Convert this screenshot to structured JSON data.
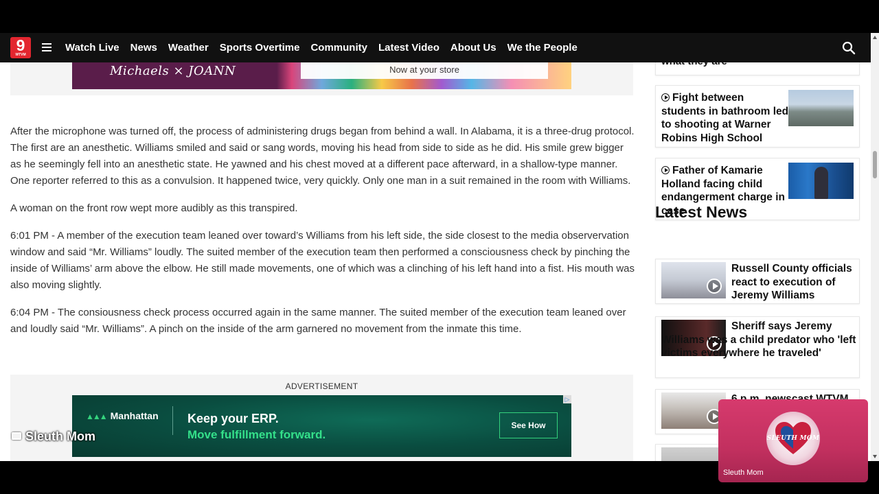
{
  "nav": {
    "logo_number": "9",
    "logo_call": "WTVM",
    "items": [
      "Watch Live",
      "News",
      "Weather",
      "Sports Overtime",
      "Community",
      "Latest Video",
      "About Us",
      "We the People"
    ]
  },
  "top_ad": {
    "brand": "Michaels × JOANN",
    "cta": "Now at your store"
  },
  "article": {
    "paragraphs": [
      "After the microphone was turned off, the process of administering drugs began from behind a wall. In Alabama, it is a three-drug protocol. The first are an anesthetic. Williams smiled and said or sang words, moving his head from side to side as he did. His smile grew bigger as he seemingly fell into an anesthetic state. He yawned and his chest moved at a different pace afterward, in a shallow-type manner. One reporter referred to this as a convulsion. It happened twice, very quickly. Only one man in a suit remained in the room with Williams.",
      "A woman on the front row wept more audibly as this transpired.",
      "6:01 PM - A member of the execution team leaned over toward’s Williams from his left side, the side closest to the media observervation window and said “Mr. Williams” loudly. The suited member of the execution team then performed a consciousness check by pinching the inside of Williams’ arm above the elbow. He still made movements, one of which was a clinching of his left hand into a fist. His mouth was also moving slightly.",
      "6:04 PM - The consiousness check process occurred again in the same manner. The suited member of the execution team leaned over and loudly said “Mr. Williams”. A pinch on the inside of the arm garnered no movement from the inmate this time."
    ]
  },
  "bottom_ad": {
    "label": "ADVERTISEMENT",
    "brand": "Manhattan",
    "line1": "Keep your ERP.",
    "line2": "Move fulfillment forward.",
    "cta": "See How"
  },
  "sidebar": {
    "partial_story": "what they are",
    "stories": [
      {
        "title": "Fight between students in bathroom led to shooting at Warner Robins High School"
      },
      {
        "title": "Father of Kamarie Holland facing child endangerment charge in case"
      }
    ],
    "latest_title": "Latest News",
    "latest": [
      {
        "title": "Russell County officials react to execution of Jeremy Williams"
      },
      {
        "title": "Sheriff says Jeremy Williams was a child predator who 'left victims everywhere he traveled'"
      },
      {
        "title": "6 p.m. newscast WTVM"
      }
    ]
  },
  "overlay": {
    "watermark": "Sleuth Mom",
    "pip_badge": "SLEUTH MOM",
    "pip_name": "Sleuth Mom"
  },
  "colors": {
    "logo_red": "#e3262f",
    "nav_bg": "#111111",
    "pip_pink": "#d63a6d",
    "manhattan_green": "#34d27d"
  },
  "icons": [
    "hamburger-menu-icon",
    "search-icon",
    "play-circle-icon",
    "video-play-icon",
    "monitor-icon",
    "heart-badge-icon"
  ]
}
